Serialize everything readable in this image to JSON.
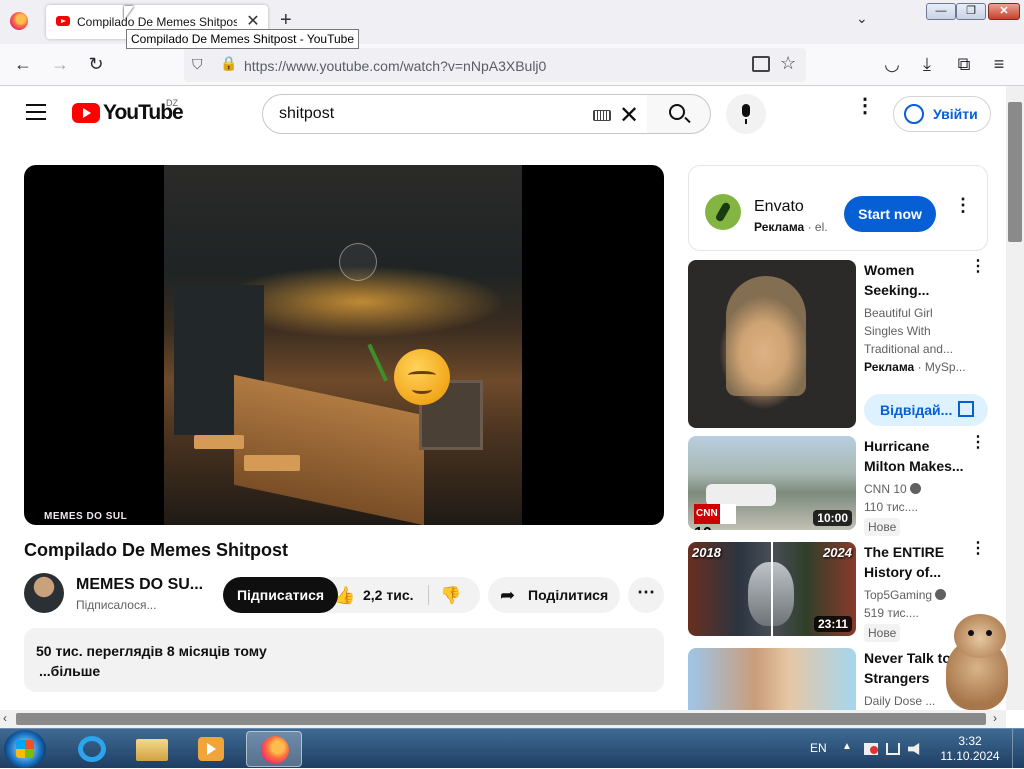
{
  "browser": {
    "tab_title": "Compilado De Memes Shitpost - YouTube",
    "tab_close": "✕",
    "new_tab": "+",
    "tab_list": "⌄",
    "tooltip": "Compilado De Memes Shitpost - YouTube",
    "url": "https://www.youtube.com/watch?v=nNpA3XBulj0",
    "window_controls": {
      "minimize": "—",
      "maximize": "❐",
      "close": "✕"
    },
    "nav_icons": {
      "back": "←",
      "forward": "→",
      "reload": "↻",
      "pocket": "◡",
      "download": "⤓",
      "extensions": "⧉",
      "menu": "≡",
      "shield": "⛉",
      "lock": "🔒",
      "star": "☆"
    }
  },
  "youtube": {
    "logo_text": "YouTube",
    "country_code": "DZ",
    "search_value": "shitpost",
    "clear_icon": "✕",
    "more_icon": "⋮",
    "signin_label": "Увійти",
    "accent": "#065fd4",
    "brand_red": "#ff0000"
  },
  "video": {
    "watermark": "MEMES DO SUL",
    "title": "Compilado De Memes Shitpost",
    "channel_name": "MEMES DO SU...",
    "subscribed_label": "Підписалося...",
    "subscribe_label": "Підписатися",
    "like_icon": "👍",
    "like_count": "2,2 тис.",
    "dislike_icon": "👎",
    "share_icon": "➦",
    "share_label": "Поділитися",
    "more_icon": "⋯",
    "stats": "50 тис. переглядів  8 місяців тому",
    "more_label": "...більше"
  },
  "sidebar": {
    "ad": {
      "title": "Envato",
      "label": "Реклама",
      "domain": " · el.",
      "cta": "Start now",
      "more_icon": "⋮"
    },
    "ad_video": {
      "title": "Women Seeking...",
      "description": "Beautiful Girl Singles With Traditional and...",
      "label": "Реклама",
      "sponsor": " · MySp...",
      "cta": "Відвідай...",
      "more_icon": "⋮"
    },
    "items": [
      {
        "title": "Hurricane Milton Makes...",
        "channel": "CNN 10",
        "meta": "110 тис....",
        "badge": "Нове",
        "duration": "10:00",
        "logo_text": "10",
        "logo_prefix": "CNN",
        "more_icon": "⋮"
      },
      {
        "title": "The ENTIRE History of...",
        "channel": "Top5Gaming",
        "meta": "519 тис....",
        "badge": "Нове",
        "duration": "23:11",
        "year_left": "2018",
        "year_right": "2024",
        "more_icon": "⋮"
      },
      {
        "title": "Never Talk to Strangers",
        "channel": "Daily Dose ...",
        "more_icon": "⋮"
      }
    ]
  },
  "scrollbars": {
    "left_arrow": "‹",
    "right_arrow": "›"
  },
  "taskbar": {
    "language": "EN",
    "tray_arrow": "▲",
    "time": "3:32",
    "date": "11.10.2024"
  }
}
